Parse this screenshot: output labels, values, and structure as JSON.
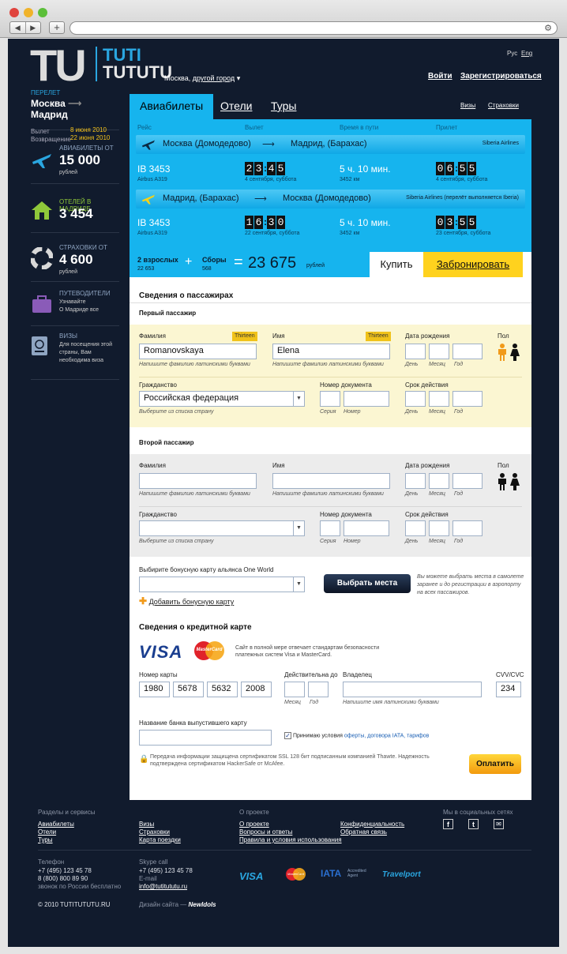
{
  "header": {
    "logo_letters": "TU",
    "logo_line1": "TUTI",
    "logo_line2": "TUTUTU",
    "city_prefix": "Москва,",
    "city_link": "другой город",
    "lang_ru": "Рус",
    "lang_en": "Eng",
    "login": "Войти",
    "register": "Зарегистрироваться"
  },
  "sidebar": {
    "route_caption": "ПЕРЕЛЕТ",
    "route_from": "Москва",
    "route_to": "Мадрид",
    "depart_label": "Вылет",
    "depart_date": "8 июня 2010",
    "return_label": "Возвращение",
    "return_date": "22 июня 2010",
    "flights_cap": "АВИАБИЛЕТЫ ОТ",
    "flights_price": "15 000",
    "flights_unit": "рублей",
    "hotels_cap": "ОТЕЛЕЙ В МАДРИДЕ",
    "hotels_count": "3 454",
    "insurance_cap": "СТРАХОВКИ ОТ",
    "insurance_price": "4 600",
    "insurance_unit": "рублей",
    "guides_cap": "ПУТЕВОДИТЕЛИ",
    "guides_text1": "Узнавайте",
    "guides_text2": "О Мадриде все",
    "visa_cap": "ВИЗЫ",
    "visa_text1": "Для посещения этой",
    "visa_text2": "страны, Вам",
    "visa_text3": "необходима виза"
  },
  "tabs": {
    "flights": "Авиабилеты",
    "hotels": "Отели",
    "tours": "Туры",
    "visas": "Визы",
    "insurance": "Страховки"
  },
  "flight": {
    "col_flight": "Рейс",
    "col_depart": "Вылет",
    "col_duration": "Время в пути",
    "col_arrive": "Прилет",
    "leg1": {
      "from": "Москва (Домодедово)",
      "to": "Мадрид, (Барахас)",
      "airline": "Siberia Airlines",
      "number": "IB 3453",
      "aircraft": "Airbus A319",
      "dep_digits": [
        "2",
        "3",
        "4",
        "5"
      ],
      "dep_date": "4 сентября, суббота",
      "duration": "5 ч. 10 мин.",
      "distance": "3452 км",
      "arr_digits": [
        "0",
        "6",
        "5",
        "5"
      ],
      "arr_date": "4 сентября, суббота"
    },
    "leg2": {
      "from": "Мадрид, (Барахас)",
      "to": "Москва (Домодедово)",
      "airline": "Siberia Airlines (перелёт выполняется Iberia)",
      "number": "IB 3453",
      "aircraft": "Airbus A319",
      "dep_digits": [
        "1",
        "6",
        "3",
        "0"
      ],
      "dep_date": "22 сентября, суббота",
      "duration": "5 ч. 10 мин.",
      "distance": "3452 км",
      "arr_digits": [
        "0",
        "3",
        "5",
        "5"
      ],
      "arr_date": "23 сентября, суббота"
    },
    "adults_label": "2 взрослых",
    "adults_price": "22 653",
    "plus": "+",
    "fees_label": "Сборы",
    "fees_price": "568",
    "equals": "=",
    "total": "23 675",
    "total_unit": "рублей",
    "buy": "Купить",
    "book": "Забронировать"
  },
  "passengers": {
    "title": "Сведения о пассажирах",
    "first": "Первый пассажир",
    "second": "Второй пассажир",
    "surname": "Фамилия",
    "name": "Имя",
    "badge": "Thirteen",
    "birth": "Дата рождения",
    "gender": "Пол",
    "latin_hint": "Напишите фамилию латинскими буквами",
    "day": "День",
    "month": "Месяц",
    "year": "Год",
    "citizenship": "Гражданство",
    "doc_number": "Номер документа",
    "validity": "Срок действия",
    "choose_country": "Выберите из списка страну",
    "series": "Серия",
    "number": "Номер",
    "p1_surname": "Romanovskaya",
    "p1_name": "Elena",
    "p1_country": "Российская федерация"
  },
  "bonus": {
    "label": "Выбирите бонусную карту альянса One World",
    "add": "Добавить бонусную карту",
    "seats_button": "Выбрать места",
    "seats_note1": "Вы можете выбрать места в самолете",
    "seats_note2": "заранее и до регистрации в аэропорту",
    "seats_note3": "на всех пассажиров."
  },
  "card": {
    "title": "Сведения о кредитной карте",
    "visa": "VISA",
    "mastercard": "MasterCard",
    "security1": "Сайт в полной мере отвечает стандартам безопасности",
    "security2": "платежных систем Visa и MasterCard.",
    "number_label": "Номер карты",
    "n1": "1980",
    "n2": "5678",
    "n3": "5632",
    "n4": "2008",
    "valid_label": "Действительна до",
    "month": "Месяц",
    "year": "Год",
    "owner_label": "Владелец",
    "owner_hint": "Напишите имя латинскими буквами",
    "cvv_label": "CVV/CVC",
    "cvv": "234",
    "bank_label": "Название банка выпустившего карту",
    "accept_prefix": "Принимаю условия",
    "accept_links": "оферты, договора IATA, тарифов",
    "ssl1": "Передача информации защищена сертификатом SSL 128 бит подписанным компанией Thawte. Надежность",
    "ssl2": "подтверждена сертификатом HackerSafe от McAfee.",
    "pay": "Оплатить"
  },
  "footer": {
    "col1_title": "Разделы и сервисы",
    "col1": [
      "Авиабилеты",
      "Отели",
      "Туры"
    ],
    "col2": [
      "Визы",
      "Страховки",
      "Карта поездки"
    ],
    "col3_title": "О проекте",
    "col3": [
      "О проекте",
      "Вопросы и ответы",
      "Правила и условия использования"
    ],
    "col4": [
      "Конфиденциальность",
      "Обратная связь"
    ],
    "social_title": "Мы в социальных сетях",
    "phone_title": "Телефон",
    "phone1": "+7 (495) 123 45 78",
    "phone2": "8 (800) 800 89 90",
    "phone_note": "звонок по России бесплатно",
    "skype_title": "Skype call",
    "skype": "+7 (495) 123 45 78",
    "email_title": "E-mail",
    "email": "info@tutitututu.ru",
    "copyright": "© 2010 TUTITUTUTU.RU",
    "design_prefix": "Дизайн сайта —",
    "design_brand": "NewIdols",
    "logo_visa": "VISA",
    "logo_mc": "MasterCard",
    "logo_iata": "IATA",
    "logo_iata_sub": "Accredited Agent",
    "logo_travelport": "Travelport"
  }
}
